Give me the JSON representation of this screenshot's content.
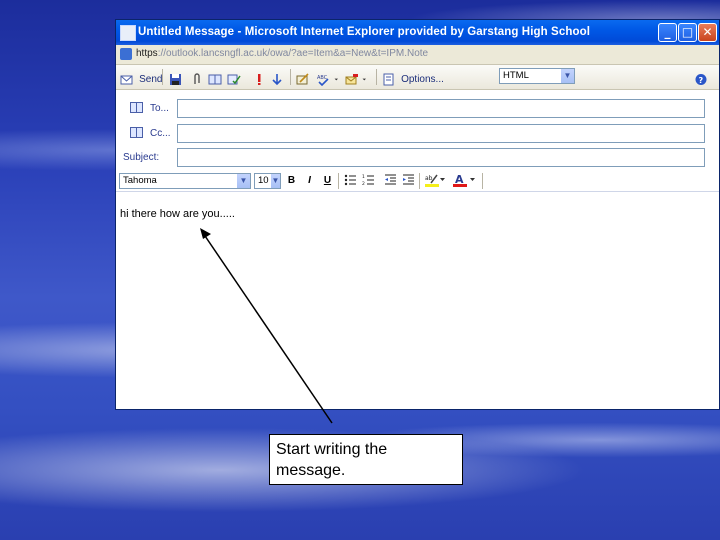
{
  "window": {
    "title": "Untitled Message - Microsoft Internet Explorer provided by Garstang High School",
    "controls": {
      "minimize": "_",
      "maximize": "□",
      "close": "✕"
    }
  },
  "address": {
    "scheme": "https",
    "rest": "://outlook.lancsngfl.ac.uk/owa/?ae=Item&a=New&t=IPM.Note"
  },
  "toolbar": {
    "send_label": "Send",
    "options_label": "Options...",
    "format_value": "HTML"
  },
  "fields": {
    "to_label": "To...",
    "cc_label": "Cc...",
    "subject_label": "Subject:"
  },
  "formatting": {
    "font": "Tahoma",
    "size": "10",
    "bold": "B",
    "italic": "I",
    "underline": "U"
  },
  "message": {
    "body": "hi there how are you....."
  },
  "annotation": {
    "callout": "Start writing the message."
  },
  "colors": {
    "titlebar": "#0058e6",
    "desktop": "#2a40b8",
    "link": "#1c2e7a"
  }
}
